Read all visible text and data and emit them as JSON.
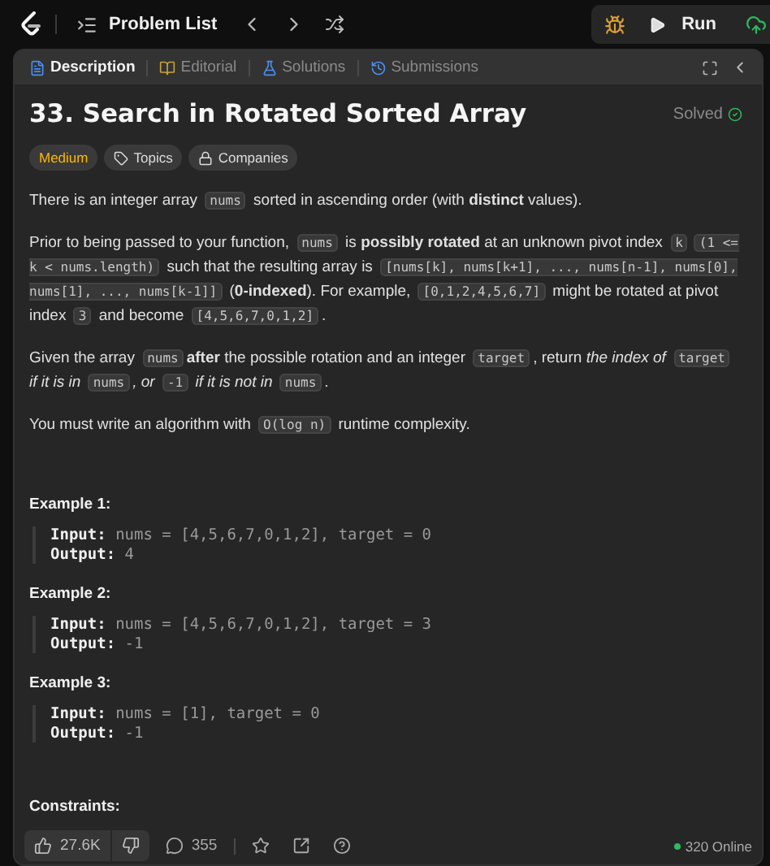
{
  "topbar": {
    "problem_list": "Problem List",
    "run": "Run"
  },
  "tabs": [
    {
      "label": "Description",
      "selected": true
    },
    {
      "label": "Editorial",
      "selected": false
    },
    {
      "label": "Solutions",
      "selected": false
    },
    {
      "label": "Submissions",
      "selected": false
    }
  ],
  "problem": {
    "title": "33. Search in Rotated Sorted Array",
    "status": "Solved",
    "difficulty": "Medium",
    "tags": [
      {
        "label": "Topics",
        "kind": "topics"
      },
      {
        "label": "Companies",
        "kind": "companies"
      }
    ]
  },
  "paragraphs": [
    [
      {
        "kind": "text",
        "text": "There is an integer array "
      },
      {
        "kind": "code",
        "text": "nums"
      },
      {
        "kind": "text",
        "text": " sorted in ascending order (with "
      },
      {
        "kind": "bold",
        "text": "distinct"
      },
      {
        "kind": "text",
        "text": " values)."
      }
    ],
    [
      {
        "kind": "text",
        "text": "Prior to being passed to your function, "
      },
      {
        "kind": "code",
        "text": "nums"
      },
      {
        "kind": "text",
        "text": " is "
      },
      {
        "kind": "bold",
        "text": "possibly rotated"
      },
      {
        "kind": "text",
        "text": " at an unknown pivot index "
      },
      {
        "kind": "code",
        "text": "k"
      },
      {
        "kind": "code",
        "text": "(1 <= k < nums.length)"
      },
      {
        "kind": "text",
        "text": " such that the resulting array is "
      },
      {
        "kind": "code",
        "text": "[nums[k], nums[k+1], ..., nums[n-1], nums[0], nums[1], ..., nums[k-1]]"
      },
      {
        "kind": "text",
        "text": " ("
      },
      {
        "kind": "bold",
        "text": "0-indexed"
      },
      {
        "kind": "text",
        "text": "). For example, "
      },
      {
        "kind": "code",
        "text": "[0,1,2,4,5,6,7]"
      },
      {
        "kind": "text",
        "text": " might be rotated at pivot index "
      },
      {
        "kind": "code",
        "text": "3"
      },
      {
        "kind": "text",
        "text": " and become "
      },
      {
        "kind": "code",
        "text": "[4,5,6,7,0,1,2]"
      },
      {
        "kind": "text",
        "text": "."
      }
    ],
    [
      {
        "kind": "text",
        "text": "Given the array "
      },
      {
        "kind": "code",
        "text": "nums"
      },
      {
        "kind": "bold",
        "text": "after"
      },
      {
        "kind": "text",
        "text": " the possible rotation and an integer "
      },
      {
        "kind": "code",
        "text": "target"
      },
      {
        "kind": "text",
        "text": ", return "
      },
      {
        "kind": "italic",
        "text": "the index of "
      },
      {
        "kind": "code",
        "text": "target"
      },
      {
        "kind": "italic",
        "text": " if it is in "
      },
      {
        "kind": "code",
        "text": "nums"
      },
      {
        "kind": "italic",
        "text": ", or "
      },
      {
        "kind": "code",
        "text": "-1"
      },
      {
        "kind": "italic",
        "text": " if it is not in "
      },
      {
        "kind": "code",
        "text": "nums"
      },
      {
        "kind": "text",
        "text": "."
      }
    ],
    [
      {
        "kind": "text",
        "text": "You must write an algorithm with "
      },
      {
        "kind": "code",
        "text": "O(log n)"
      },
      {
        "kind": "text",
        "text": " runtime complexity."
      }
    ]
  ],
  "examples": [
    {
      "title": "Example 1:",
      "input_label": "Input:",
      "input": "nums = [4,5,6,7,0,1,2], target = 0",
      "output_label": "Output:",
      "output": "4"
    },
    {
      "title": "Example 2:",
      "input_label": "Input:",
      "input": "nums = [4,5,6,7,0,1,2], target = 3",
      "output_label": "Output:",
      "output": "-1"
    },
    {
      "title": "Example 3:",
      "input_label": "Input:",
      "input": "nums = [1], target = 0",
      "output_label": "Output:",
      "output": "-1"
    }
  ],
  "constraints_title": "Constraints:",
  "footer": {
    "likes": "27.6K",
    "comments": "355",
    "online": "320 Online"
  }
}
